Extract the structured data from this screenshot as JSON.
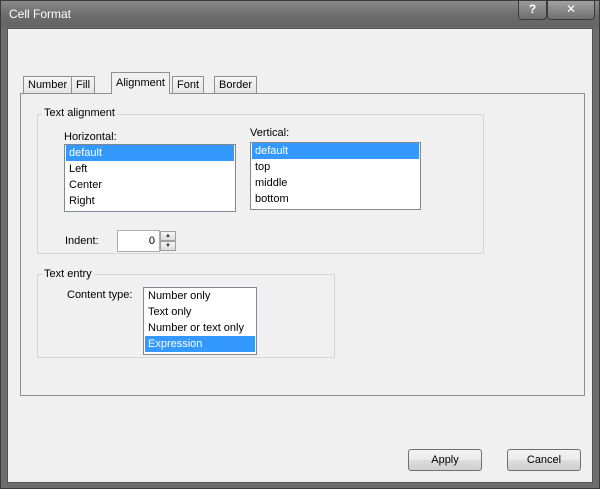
{
  "window": {
    "title": "Cell Format",
    "help_glyph": "?",
    "close_glyph": "✕"
  },
  "tabs": [
    {
      "label": "Number"
    },
    {
      "label": "Fill"
    },
    {
      "label": "Alignment"
    },
    {
      "label": "Font"
    },
    {
      "label": "Border"
    }
  ],
  "active_tab": "Alignment",
  "text_alignment": {
    "group_label": "Text alignment",
    "horizontal": {
      "label": "Horizontal:",
      "items": [
        "default",
        "Left",
        "Center",
        "Right"
      ],
      "selected": "default"
    },
    "vertical": {
      "label": "Vertical:",
      "items": [
        "default",
        "top",
        "middle",
        "bottom"
      ],
      "selected": "default"
    },
    "indent": {
      "label": "Indent:",
      "value": "0",
      "up_glyph": "▲",
      "down_glyph": "▼"
    }
  },
  "text_entry": {
    "group_label": "Text entry",
    "content_type": {
      "label": "Content type:",
      "items": [
        "Number only",
        "Text only",
        "Number or text only",
        "Expression"
      ],
      "selected": "Expression"
    }
  },
  "buttons": {
    "apply": "Apply",
    "cancel": "Cancel"
  },
  "colors": {
    "selection": "#3399ff",
    "dialog_bg": "#f0f0f0",
    "titlebar": "#6e6e6e"
  }
}
